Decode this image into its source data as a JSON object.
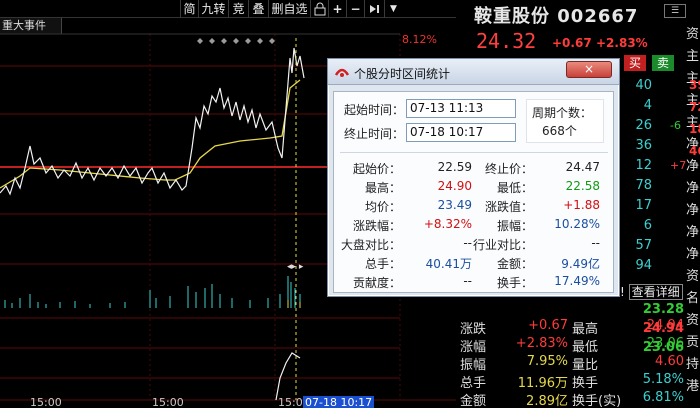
{
  "toolbar": {
    "items": [
      "简",
      "九转",
      "竞",
      "叠",
      "删自选"
    ],
    "lock_icon": "lock-icon",
    "plus_icon": "plus-icon",
    "minus_icon": "minus-icon",
    "forward_icon": "skip-forward-icon",
    "dropdown_icon": "chevron-down-icon"
  },
  "event_tab": "重大事件",
  "chart": {
    "top_pct": "8.12%",
    "time_labels": [
      "15:00",
      "15:00",
      "15:0"
    ],
    "selection_label": "07-18 10:17",
    "colors": {
      "price": "#ffffff",
      "avg": "#e6d84a",
      "ref_line": "#c0201e",
      "volume": "#3bd0d0",
      "grid": "#6b0b0b"
    }
  },
  "quote": {
    "name": "鞍重股份",
    "code": "002667",
    "price": "24.32",
    "change": "+0.67",
    "change_pct": "+2.83%",
    "buy_label": "买",
    "sell_label": "卖",
    "right_col_chars": [
      "资",
      "主",
      "主",
      "主",
      "主",
      "净",
      "净",
      "净",
      "净",
      "净",
      "净",
      "资",
      "名",
      "资",
      "贡",
      "持",
      "港"
    ],
    "right_col_nums": [
      "39",
      "72",
      "18",
      "46"
    ],
    "right_col_small": [
      "-6",
      "+7"
    ],
    "mid_nums": [
      "40",
      "4",
      "26",
      "36",
      "12",
      "78",
      "17",
      "6",
      "57",
      "94"
    ],
    "detail_link": "查看详细",
    "detail_prefix": "!",
    "rows": [
      {
        "l1": "涨跌",
        "v1": "+0.67",
        "l2": "最高",
        "v2": "24.94",
        "c1": "red",
        "c2": "red"
      },
      {
        "l1": "涨幅",
        "v1": "+2.83%",
        "l2": "最低",
        "v2": "23.06",
        "c1": "red",
        "c2": "grn"
      },
      {
        "l1": "振幅",
        "v1": "7.95%",
        "l2": "量比",
        "v2": "4.60",
        "c1": "yel",
        "c2": "red"
      },
      {
        "l1": "总手",
        "v1": "11.96万",
        "l2": "换手",
        "v2": "5.18%",
        "c1": "yel",
        "c2": "cyan"
      },
      {
        "l1": "金额",
        "v1": "2.89亿",
        "l2": "换手(实)",
        "v2": "6.81%",
        "c1": "yel",
        "c2": "cyan"
      }
    ],
    "upper_vals": [
      "23.28",
      "24.94",
      "23.06"
    ]
  },
  "dialog": {
    "title": "个股分时区间统计",
    "close_label": "×",
    "start_label": "起始时间：",
    "start_value": "07-13 11:13",
    "end_label": "终止时间：",
    "end_value": "07-18 10:17",
    "period_label": "周期个数：",
    "period_value": "668个",
    "stats": [
      {
        "l1": "起始价：",
        "v1": "22.59",
        "c1": "#222",
        "l2": "终止价：",
        "v2": "24.47",
        "c2": "#222"
      },
      {
        "l1": "最高：",
        "v1": "24.90",
        "c1": "#d01010",
        "l2": "最低：",
        "v2": "22.58",
        "c2": "#129912"
      },
      {
        "l1": "均价：",
        "v1": "23.49",
        "c1": "#1a4fa0",
        "l2": "涨跌值：",
        "v2": "+1.88",
        "c2": "#d01010"
      },
      {
        "l1": "涨跌幅：",
        "v1": "+8.32%",
        "c1": "#d01010",
        "l2": "振幅：",
        "v2": "10.28%",
        "c2": "#1a4fa0"
      },
      {
        "l1": "大盘对比：",
        "v1": "--",
        "c1": "#222",
        "l2": "行业对比：",
        "v2": "--",
        "c2": "#222"
      },
      {
        "l1": "总手：",
        "v1": "40.41万",
        "c1": "#1a4fa0",
        "l2": "金额：",
        "v2": "9.49亿",
        "c2": "#1a4fa0"
      },
      {
        "l1": "贡献度：",
        "v1": "--",
        "c1": "#222",
        "l2": "换手：",
        "v2": "17.49%",
        "c2": "#1a4fa0"
      }
    ]
  }
}
